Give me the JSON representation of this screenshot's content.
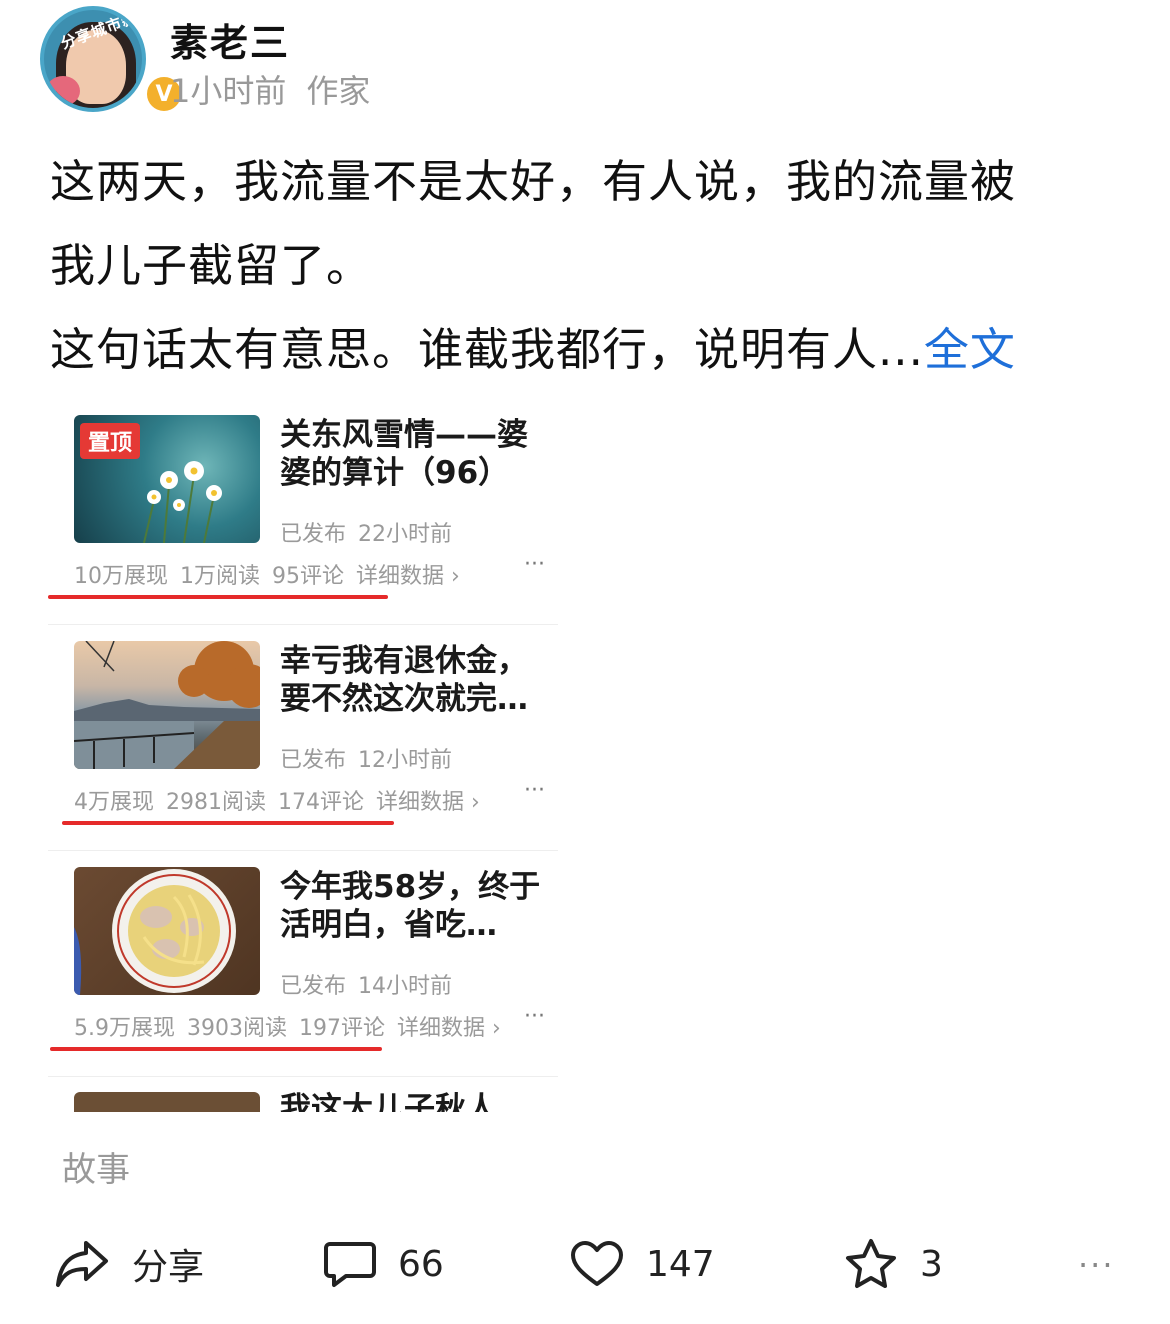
{
  "author": {
    "avatar_ring_text": "分享城市新鲜事",
    "verified_badge": "V",
    "name": "素老三",
    "time": "1小时前",
    "role": "作家"
  },
  "post": {
    "line1": "这两天，我流量不是太好，有人说，我的流量被",
    "line2": "我儿子截留了。",
    "line3": "这句话太有意思。谁截我都行，说明有人...",
    "full_text_link": "全文"
  },
  "articles": [
    {
      "pinned_label": "置顶",
      "title": "关东风雪情——婆婆的算计（96）",
      "status": "已发布",
      "time": "22小时前",
      "impressions": "10万展现",
      "reads": "1万阅读",
      "comments": "95评论",
      "details": "详细数据 ›",
      "more": "···",
      "thumb_icon": "flower-photo"
    },
    {
      "title": "幸亏我有退休金，要不然这次就完…",
      "status": "已发布",
      "time": "12小时前",
      "impressions": "4万展现",
      "reads": "2981阅读",
      "comments": "174评论",
      "details": "详细数据 ›",
      "more": "···",
      "thumb_icon": "lakeside-photo"
    },
    {
      "title": "今年我58岁，终于活明白，省吃…",
      "status": "已发布",
      "time": "14小时前",
      "impressions": "5.9万展现",
      "reads": "3903阅读",
      "comments": "197评论",
      "details": "详细数据 ›",
      "more": "···",
      "thumb_icon": "noodle-bowl-photo"
    },
    {
      "title": "我这大儿子秋人",
      "thumb_icon": "partial-photo"
    }
  ],
  "tag": "故事",
  "actions": {
    "share_label": "分享",
    "comments_count": "66",
    "likes_count": "147",
    "favorites_count": "3",
    "more": "···"
  },
  "colors": {
    "link": "#1e6fd9",
    "underline_annotation": "#e52a2a",
    "pin_badge": "#e53935",
    "verified": "#f3b02c"
  }
}
